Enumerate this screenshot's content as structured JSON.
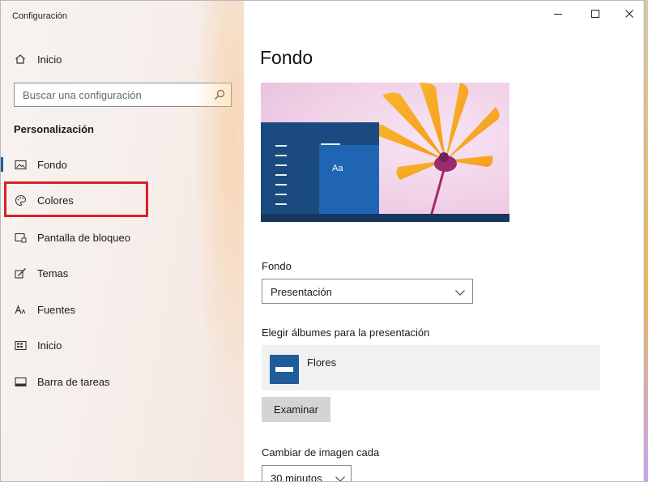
{
  "window": {
    "title": "Configuración",
    "controls": {
      "minimize_icon": "minimize-icon",
      "maximize_icon": "maximize-icon",
      "close_icon": "close-icon"
    }
  },
  "sidebar": {
    "home": {
      "label": "Inicio",
      "icon": "home-icon"
    },
    "search": {
      "placeholder": "Buscar una configuración",
      "value": "",
      "icon": "search-icon"
    },
    "section_title": "Personalización",
    "items": [
      {
        "label": "Fondo",
        "icon": "picture-icon",
        "selected": true
      },
      {
        "label": "Colores",
        "icon": "palette-icon",
        "selected": false,
        "highlighted": true
      },
      {
        "label": "Pantalla de bloqueo",
        "icon": "lock-screen-icon",
        "selected": false
      },
      {
        "label": "Temas",
        "icon": "brush-icon",
        "selected": false
      },
      {
        "label": "Fuentes",
        "icon": "font-icon",
        "selected": false
      },
      {
        "label": "Inicio",
        "icon": "start-icon",
        "selected": false
      },
      {
        "label": "Barra de tareas",
        "icon": "taskbar-icon",
        "selected": false
      }
    ]
  },
  "main": {
    "page_title": "Fondo",
    "preview": {
      "sample_text": "Aa",
      "accent": "#1f65b3"
    },
    "background": {
      "label": "Fondo",
      "selected": "Presentación"
    },
    "albums": {
      "label": "Elegir álbumes para la presentación",
      "items": [
        {
          "name": "Flores",
          "icon": "album-icon"
        }
      ],
      "browse_button": "Examinar"
    },
    "interval": {
      "label": "Cambiar de imagen cada",
      "selected": "30 minutos"
    }
  },
  "colors": {
    "accent": "#1f5c99",
    "highlight_box": "#d9202a",
    "button_bg": "#d4d4d4"
  }
}
